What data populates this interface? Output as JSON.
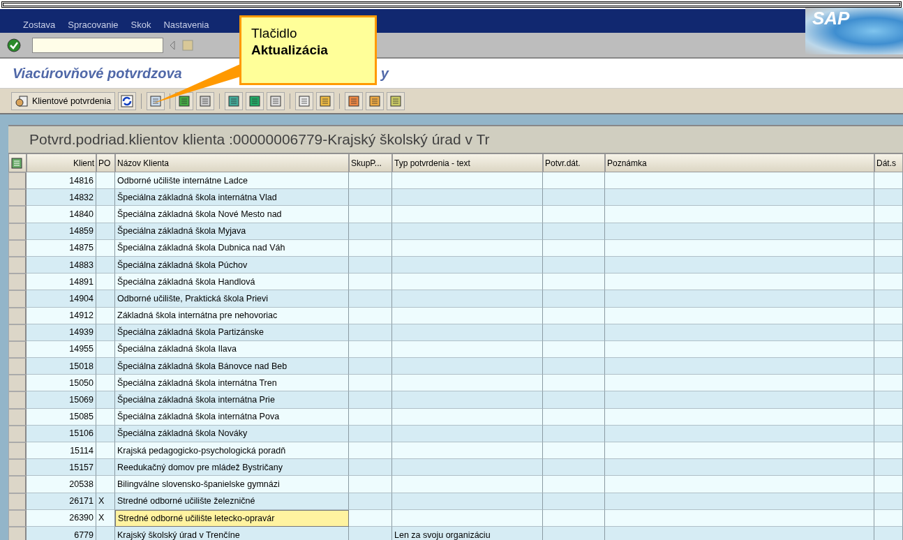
{
  "menu": [
    "Zostava",
    "Spracovanie",
    "Skok",
    "Nastavenia"
  ],
  "logo": "SAP",
  "title": [
    "Viacúrovňové potvrdzova",
    "y"
  ],
  "app_toolbar": {
    "button_label": "Klientové potvrdenia"
  },
  "callout": {
    "line1": "Tlačidlo",
    "line2": "Aktualizácia"
  },
  "table": {
    "title": "Potvrd.podriad.klientov klienta :00000006779-Krajský školský úrad v Tr",
    "columns": [
      "Klient",
      "PO",
      "Názov Klienta",
      "SkupP...",
      "Typ potvrdenia - text",
      "Potvr.dát.",
      "Poznámka",
      "Dát.s"
    ],
    "rows": [
      {
        "klient": "14816",
        "po": "",
        "name": "Odborné učilište internátne Ladce",
        "typ": "",
        "selected": false
      },
      {
        "klient": "14832",
        "po": "",
        "name": "Špeciálna základná škola internátna Vlad",
        "typ": "",
        "selected": false
      },
      {
        "klient": "14840",
        "po": "",
        "name": "Špeciálna základná škola Nové Mesto nad",
        "typ": "",
        "selected": false
      },
      {
        "klient": "14859",
        "po": "",
        "name": "Špeciálna základná škola Myjava",
        "typ": "",
        "selected": false
      },
      {
        "klient": "14875",
        "po": "",
        "name": "Špeciálna základná škola Dubnica nad Váh",
        "typ": "",
        "selected": false
      },
      {
        "klient": "14883",
        "po": "",
        "name": "Špeciálna základná škola Púchov",
        "typ": "",
        "selected": false
      },
      {
        "klient": "14891",
        "po": "",
        "name": "Špeciálna základná škola Handlová",
        "typ": "",
        "selected": false
      },
      {
        "klient": "14904",
        "po": "",
        "name": "Odborné učilište, Praktická škola Prievi",
        "typ": "",
        "selected": false
      },
      {
        "klient": "14912",
        "po": "",
        "name": "Základná škola internátna pre nehovoriac",
        "typ": "",
        "selected": false
      },
      {
        "klient": "14939",
        "po": "",
        "name": "Špeciálna základná škola Partizánske",
        "typ": "",
        "selected": false
      },
      {
        "klient": "14955",
        "po": "",
        "name": "Špeciálna základná škola Ilava",
        "typ": "",
        "selected": false
      },
      {
        "klient": "15018",
        "po": "",
        "name": "Špeciálna základná škola Bánovce nad Beb",
        "typ": "",
        "selected": false
      },
      {
        "klient": "15050",
        "po": "",
        "name": "Špeciálna základná škola internátna Tren",
        "typ": "",
        "selected": false
      },
      {
        "klient": "15069",
        "po": "",
        "name": "Špeciálna základná škola internátna Prie",
        "typ": "",
        "selected": false
      },
      {
        "klient": "15085",
        "po": "",
        "name": "Špeciálna základná škola internátna Pova",
        "typ": "",
        "selected": false
      },
      {
        "klient": "15106",
        "po": "",
        "name": "Špeciálna základná škola Nováky",
        "typ": "",
        "selected": false
      },
      {
        "klient": "15114",
        "po": "",
        "name": "Krajská pedagogicko-psychologická poradň",
        "typ": "",
        "selected": false
      },
      {
        "klient": "15157",
        "po": "",
        "name": "Reedukačný domov pre mládež Bystričany",
        "typ": "",
        "selected": false
      },
      {
        "klient": "20538",
        "po": "",
        "name": "Bilingválne slovensko-španielske gymnázi",
        "typ": "",
        "selected": false
      },
      {
        "klient": "26171",
        "po": "X",
        "name": "Stredné odborné učilište železničné",
        "typ": "",
        "selected": false
      },
      {
        "klient": "26390",
        "po": "X",
        "name": "Stredné odborné učilište letecko-opravár",
        "typ": "",
        "selected": true
      },
      {
        "klient": "6779",
        "po": "",
        "name": "Krajský školský úrad v Trenčíne",
        "typ": "Len za svoju organizáciu",
        "selected": false
      }
    ]
  }
}
